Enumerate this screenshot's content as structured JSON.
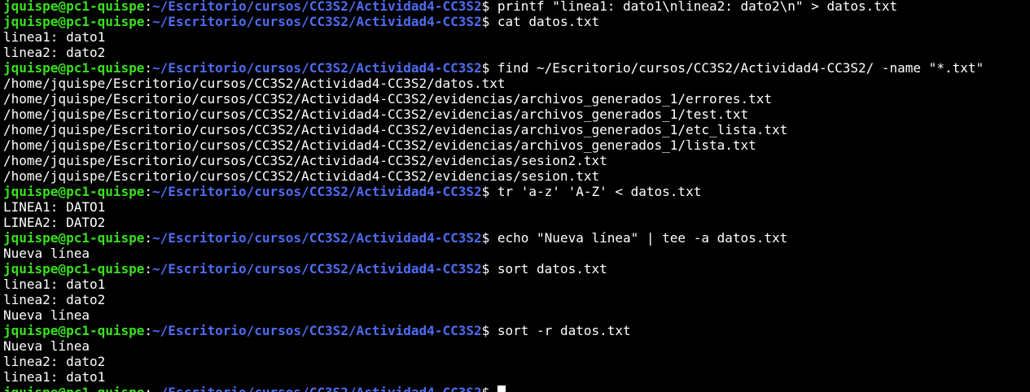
{
  "terminal": {
    "colors": {
      "background": "#000000",
      "foreground": "#ffffff",
      "user_host": "#39e11d",
      "path": "#4f6cf2"
    },
    "prompt": {
      "user_host": "jquispe@pc1-quispe",
      "colon": ":",
      "path": "~/Escritorio/cursos/CC3S2/Actividad4-CC3S2",
      "symbol": "$ "
    },
    "lines": [
      {
        "type": "prompt",
        "command": "printf \"linea1: dato1\\nlinea2: dato2\\n\" > datos.txt"
      },
      {
        "type": "prompt",
        "command": "cat datos.txt"
      },
      {
        "type": "output",
        "text": "linea1: dato1"
      },
      {
        "type": "output",
        "text": "linea2: dato2"
      },
      {
        "type": "prompt",
        "command": "find ~/Escritorio/cursos/CC3S2/Actividad4-CC3S2/ -name \"*.txt\""
      },
      {
        "type": "output",
        "text": "/home/jquispe/Escritorio/cursos/CC3S2/Actividad4-CC3S2/datos.txt"
      },
      {
        "type": "output",
        "text": "/home/jquispe/Escritorio/cursos/CC3S2/Actividad4-CC3S2/evidencias/archivos_generados_1/errores.txt"
      },
      {
        "type": "output",
        "text": "/home/jquispe/Escritorio/cursos/CC3S2/Actividad4-CC3S2/evidencias/archivos_generados_1/test.txt"
      },
      {
        "type": "output",
        "text": "/home/jquispe/Escritorio/cursos/CC3S2/Actividad4-CC3S2/evidencias/archivos_generados_1/etc_lista.txt"
      },
      {
        "type": "output",
        "text": "/home/jquispe/Escritorio/cursos/CC3S2/Actividad4-CC3S2/evidencias/archivos_generados_1/lista.txt"
      },
      {
        "type": "output",
        "text": "/home/jquispe/Escritorio/cursos/CC3S2/Actividad4-CC3S2/evidencias/sesion2.txt"
      },
      {
        "type": "output",
        "text": "/home/jquispe/Escritorio/cursos/CC3S2/Actividad4-CC3S2/evidencias/sesion.txt"
      },
      {
        "type": "prompt",
        "command": "tr 'a-z' 'A-Z' < datos.txt"
      },
      {
        "type": "output",
        "text": "LINEA1: DATO1"
      },
      {
        "type": "output",
        "text": "LINEA2: DATO2"
      },
      {
        "type": "prompt",
        "command": "echo \"Nueva línea\" | tee -a datos.txt"
      },
      {
        "type": "output",
        "text": "Nueva línea"
      },
      {
        "type": "prompt",
        "command": "sort datos.txt"
      },
      {
        "type": "output",
        "text": "linea1: dato1"
      },
      {
        "type": "output",
        "text": "linea2: dato2"
      },
      {
        "type": "output",
        "text": "Nueva línea"
      },
      {
        "type": "prompt",
        "command": "sort -r datos.txt"
      },
      {
        "type": "output",
        "text": "Nueva línea"
      },
      {
        "type": "output",
        "text": "linea2: dato2"
      },
      {
        "type": "output",
        "text": "linea1: dato1"
      },
      {
        "type": "prompt",
        "command": "",
        "cursor": true
      }
    ]
  }
}
